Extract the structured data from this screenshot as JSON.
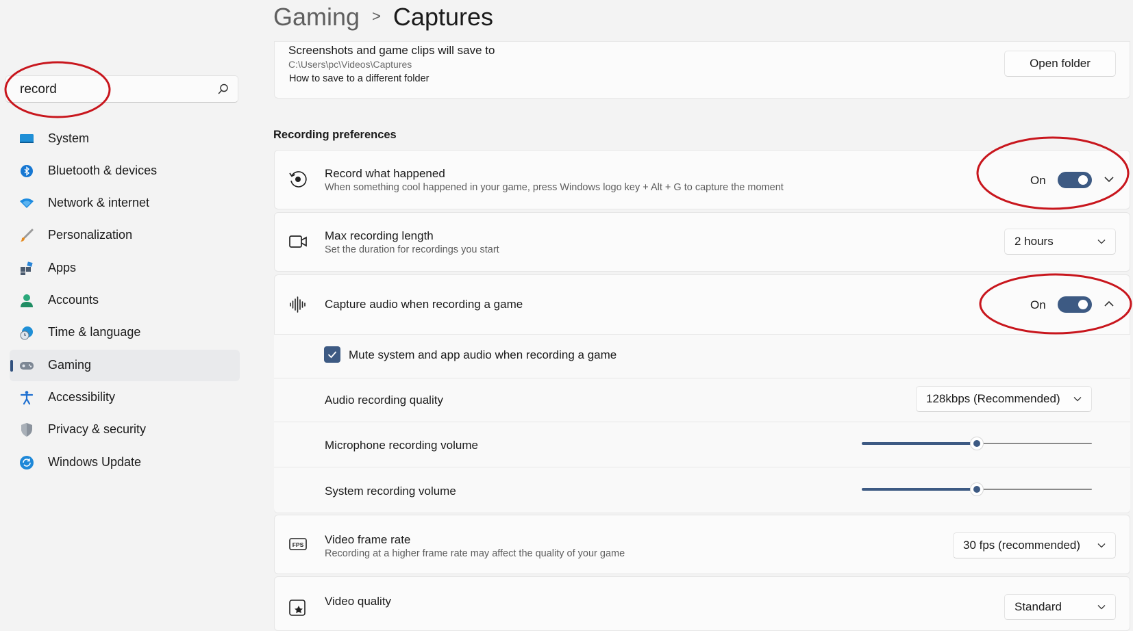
{
  "search": {
    "value": "record"
  },
  "nav": {
    "items": [
      {
        "label": "System",
        "icon": "system-icon"
      },
      {
        "label": "Bluetooth & devices",
        "icon": "bluetooth-icon"
      },
      {
        "label": "Network & internet",
        "icon": "wifi-icon"
      },
      {
        "label": "Personalization",
        "icon": "brush-icon"
      },
      {
        "label": "Apps",
        "icon": "apps-icon"
      },
      {
        "label": "Accounts",
        "icon": "person-icon"
      },
      {
        "label": "Time & language",
        "icon": "globe-clock-icon"
      },
      {
        "label": "Gaming",
        "icon": "gamepad-icon",
        "active": true
      },
      {
        "label": "Accessibility",
        "icon": "accessibility-icon"
      },
      {
        "label": "Privacy & security",
        "icon": "shield-icon"
      },
      {
        "label": "Windows Update",
        "icon": "update-icon"
      }
    ]
  },
  "header": {
    "crumb": "Gaming",
    "title": "Captures"
  },
  "captures_location": {
    "title": "Screenshots and game clips will save to",
    "path": "C:\\Users\\pc\\Videos\\Captures",
    "link": "How to save to a different folder",
    "button": "Open folder"
  },
  "recording": {
    "section_title": "Recording preferences",
    "record_what_happened": {
      "title": "Record what happened",
      "desc": "When something cool happened in your game, press Windows logo key + Alt + G to capture the moment",
      "state": "On"
    },
    "max_length": {
      "title": "Max recording length",
      "desc": "Set the duration for recordings you start",
      "value": "2 hours"
    },
    "capture_audio": {
      "title": "Capture audio when recording a game",
      "state": "On",
      "mute_label": "Mute system and app audio when recording a game",
      "mute_checked": true,
      "quality_label": "Audio recording quality",
      "quality_value": "128kbps (Recommended)",
      "mic_label": "Microphone recording volume",
      "mic_level": 0.5,
      "system_label": "System recording volume",
      "system_level": 0.5
    },
    "frame_rate": {
      "title": "Video frame rate",
      "desc": "Recording at a higher frame rate may affect the quality of your game",
      "value": "30 fps (recommended)"
    },
    "video_quality": {
      "title": "Video quality",
      "value": "Standard"
    }
  },
  "colors": {
    "accent": "#3d5a83",
    "annotation": "#c8161d"
  }
}
